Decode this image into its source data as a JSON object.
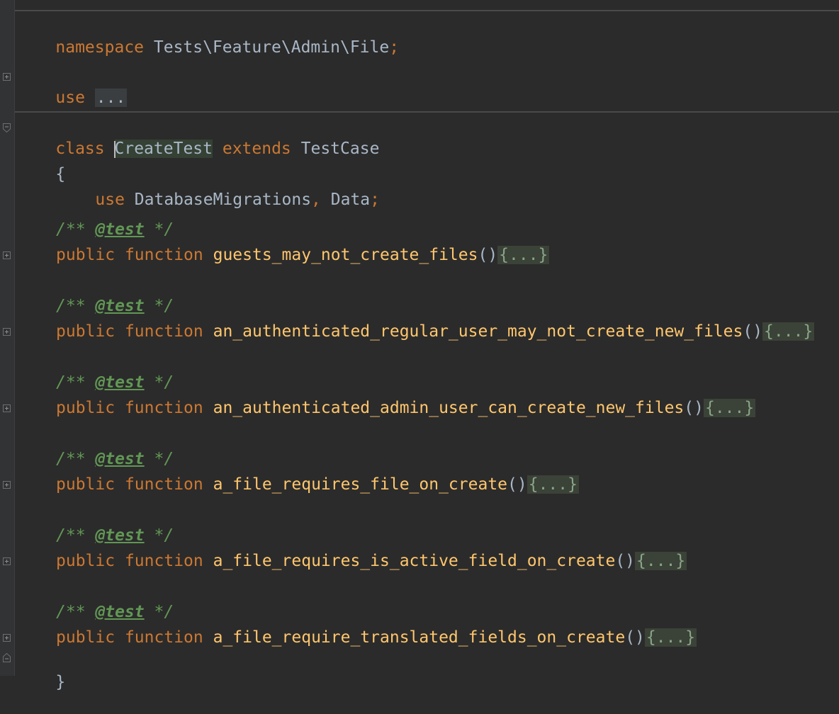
{
  "code": {
    "namespace_kw": "namespace",
    "namespace_name": "Tests\\Feature\\Admin\\File",
    "semicolon": ";",
    "use_kw": "use",
    "use_folded": "...",
    "class_kw": "class",
    "class_name_first": "C",
    "class_name_rest": "reateTest",
    "extends_kw": "extends",
    "parent_class": "TestCase",
    "open_brace": "{",
    "close_brace": "}",
    "trait_use_kw": "use",
    "traits": "DatabaseMigrations",
    "comma": ",",
    "trait_2": "Data",
    "doc_open": "/** ",
    "doc_tag": "@test",
    "doc_close": " */",
    "public_kw": "public",
    "function_kw": "function",
    "parens": "()",
    "folded_body": "{...}",
    "methods": [
      {
        "name": "guests_may_not_create_files"
      },
      {
        "name": "an_authenticated_regular_user_may_not_create_new_files"
      },
      {
        "name": "an_authenticated_admin_user_can_create_new_files"
      },
      {
        "name": "a_file_requires_file_on_create"
      },
      {
        "name": "a_file_requires_is_active_field_on_create"
      },
      {
        "name": "a_file_require_translated_fields_on_create"
      }
    ]
  },
  "colors": {
    "background": "#2b2b2b",
    "keyword": "#cc7832",
    "function_name": "#ffc66d",
    "plain": "#a9b7c6",
    "doc_comment": "#629755"
  },
  "icons": {
    "fold_collapsed": "plus-fold-icon",
    "fold_expanded": "minus-fold-icon"
  }
}
